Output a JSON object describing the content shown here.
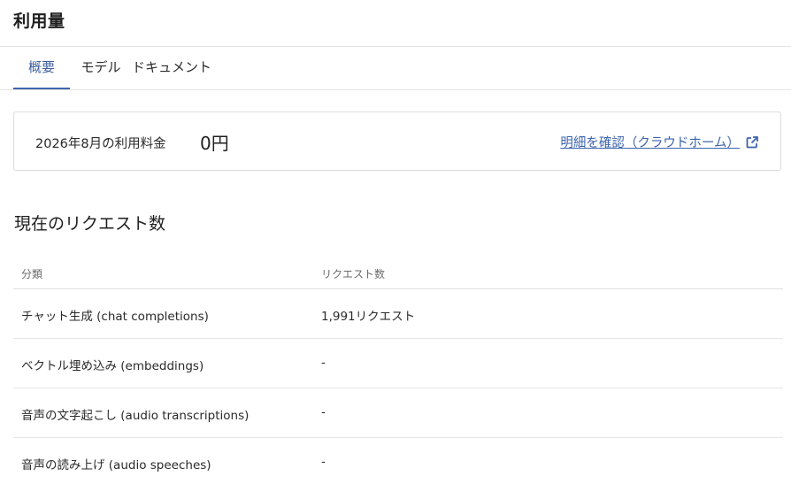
{
  "header": {
    "title": "利用量"
  },
  "tabs": [
    {
      "label": "概要",
      "active": true
    },
    {
      "label": "モデル",
      "active": false
    },
    {
      "label": "ドキュメント",
      "active": false
    }
  ],
  "cost_card": {
    "label": "2026年8月の利用料金",
    "value": "0円",
    "link_label": "明細を確認（クラウドホーム）",
    "link_icon": "external-link-icon"
  },
  "requests": {
    "title": "現在のリクエスト数",
    "columns": [
      "分類",
      "リクエスト数"
    ],
    "rows": [
      {
        "category": "チャット生成 (chat completions)",
        "count": "1,991リクエスト"
      },
      {
        "category": "ベクトル埋め込み (embeddings)",
        "count": "-"
      },
      {
        "category": "音声の文字起こし (audio transcriptions)",
        "count": "-"
      },
      {
        "category": "音声の読み上げ (audio speeches)",
        "count": "-"
      }
    ]
  },
  "colors": {
    "accent": "#3d64ad",
    "divider": "#e3e3e3",
    "text": "#222222"
  }
}
